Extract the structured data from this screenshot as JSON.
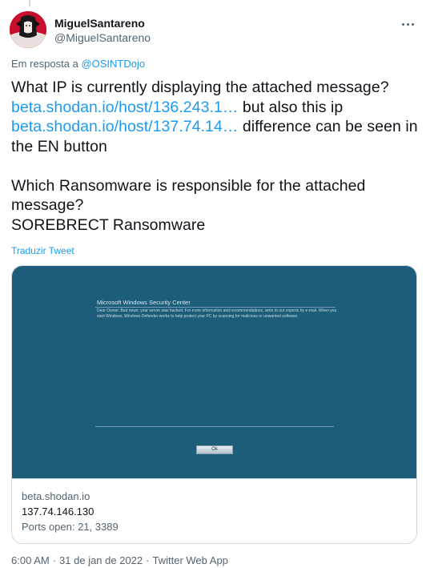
{
  "author": {
    "display_name": "MiguelSantareno",
    "handle": "@MiguelSantareno",
    "avatar_icon": "avatar-image"
  },
  "reply": {
    "prefix": "Em resposta a",
    "mention": "@OSINTDojo"
  },
  "tweet": {
    "line1": "What IP is currently displaying the attached message?",
    "link1": "beta.shodan.io/host/136.243.1…",
    "text_after_link1": " but also this ip",
    "link2": "beta.shodan.io/host/137.74.14…",
    "text_after_link2": " difference can be seen in the EN button",
    "para2_line1": "Which Ransomware is responsible for the attached message?",
    "para2_line2": "SOREBRECT Ransomware"
  },
  "translate_label": "Traduzir Tweet",
  "card": {
    "dialog_title": "Microsoft Windows Security Center",
    "dialog_body": "Dear Owner. Bad news: your server was hacked. For more information and recommendations, write to our experts by e-mail. When you start Windows, Windows Defender works to help protect your PC by scanning for malicious or unwanted software.",
    "ok_label": "Ok",
    "domain": "beta.shodan.io",
    "ip": "137.74.146.130",
    "ports": "Ports open: 21, 3389",
    "bg_color": "#1d5d7a"
  },
  "meta": {
    "time": "6:00 AM",
    "date": "31 de jan de 2022",
    "source": "Twitter Web App"
  },
  "colors": {
    "link": "#1d9bf0",
    "secondary": "#536471",
    "text": "#0f1419"
  }
}
